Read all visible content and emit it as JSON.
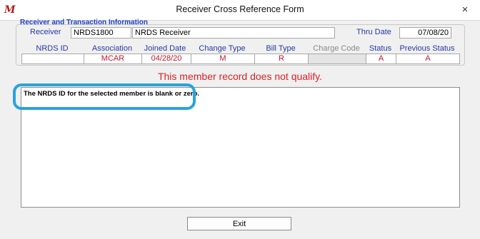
{
  "window": {
    "title": "Receiver Cross Reference Form",
    "app_icon_glyph": "M",
    "close_glyph": "×"
  },
  "receiver_section": {
    "title": "Receiver and Transaction Information",
    "receiver_label": "Receiver",
    "receiver_code": "NRDS1800",
    "receiver_name": "NRDS Receiver",
    "thru_date_label": "Thru Date",
    "thru_date": "07/08/20"
  },
  "columns": [
    {
      "header": "NRDS  ID",
      "value": ""
    },
    {
      "header": "Association",
      "value": "MCAR"
    },
    {
      "header": "Joined Date",
      "value": "04/28/20"
    },
    {
      "header": "Change Type",
      "value": "M"
    },
    {
      "header": "Bill Type",
      "value": "R"
    },
    {
      "header": "Charge Code",
      "value": ""
    },
    {
      "header": "Status",
      "value": "A"
    },
    {
      "header": "Previous Status",
      "value": "A"
    }
  ],
  "message": "This member record does not qualify.",
  "detail_text": "The NRDS ID for the selected member is blank or zero.",
  "exit_label": "Exit",
  "colors": {
    "section_title": "#1f3fc6",
    "label": "#2338a8",
    "value": "#c0182c",
    "message": "#d92323",
    "highlight": "#2aa2dd"
  },
  "icons": [
    "app-logo-icon",
    "close-icon"
  ]
}
